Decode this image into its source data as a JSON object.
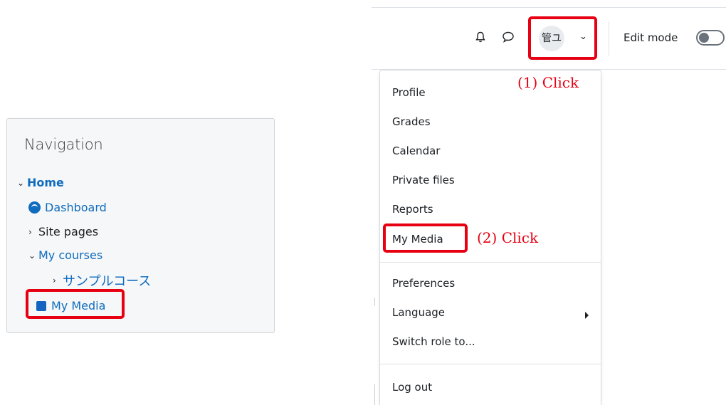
{
  "navigation": {
    "title": "Navigation",
    "home": "Home",
    "dashboard": "Dashboard",
    "site_pages": "Site pages",
    "my_courses": "My courses",
    "course": "サンプルコース",
    "my_media": "My Media"
  },
  "topbar": {
    "avatar_initials": "管ユ",
    "edit_mode_label": "Edit mode",
    "edit_mode_on": false
  },
  "user_menu": {
    "items": [
      "Profile",
      "Grades",
      "Calendar",
      "Private files",
      "Reports",
      "My Media"
    ],
    "items2": [
      "Preferences",
      "Language",
      "Switch role to..."
    ],
    "logout": "Log out"
  },
  "annotations": {
    "step1": "(1) Click",
    "step2": "(2) Click"
  },
  "colors": {
    "highlight_red": "#e60012",
    "link_blue": "#0f6cbf"
  }
}
